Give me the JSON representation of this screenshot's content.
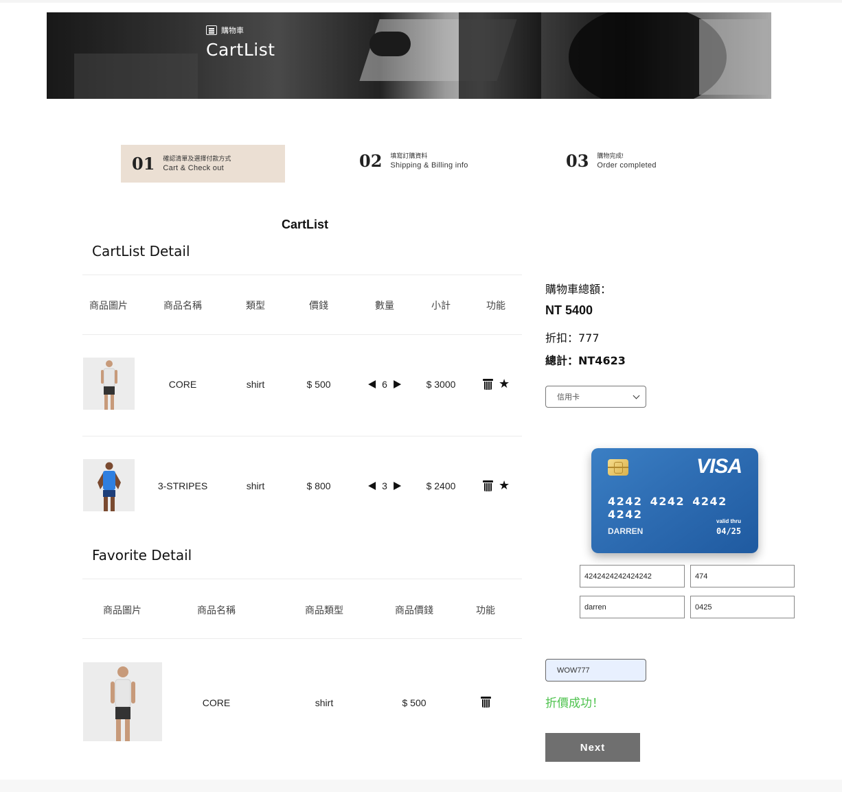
{
  "banner": {
    "subtitle": "購物車",
    "title": "CartList",
    "icon": "list-icon"
  },
  "steps": [
    {
      "num": "01",
      "zh": "確認清單及選擇付款方式",
      "en": "Cart & Check out",
      "active": true
    },
    {
      "num": "02",
      "zh": "填寫訂購資料",
      "en": "Shipping & Billing info",
      "active": false
    },
    {
      "num": "03",
      "zh": "購物完成!",
      "en": "Order completed",
      "active": false
    }
  ],
  "heading": "CartList",
  "cart": {
    "title": "CartList Detail",
    "headers": [
      "商品圖片",
      "商品名稱",
      "類型",
      "價錢",
      "數量",
      "小計",
      "功能"
    ],
    "rows": [
      {
        "name": "CORE",
        "type": "shirt",
        "price": "$ 500",
        "qty": "6",
        "subtotal": "$ 3000",
        "shirt_color": "#e6e6e6"
      },
      {
        "name": "3-STRIPES",
        "type": "shirt",
        "price": "$ 800",
        "qty": "3",
        "subtotal": "$ 2400",
        "shirt_color": "#2f7fe0"
      }
    ]
  },
  "favorite": {
    "title": "Favorite Detail",
    "headers": [
      "商品圖片",
      "商品名稱",
      "商品類型",
      "商品價錢",
      "功能"
    ],
    "rows": [
      {
        "name": "CORE",
        "type": "shirt",
        "price": "$ 500",
        "shirt_color": "#e6e6e6"
      }
    ]
  },
  "summary": {
    "label": "購物車總額：",
    "total": "NT 5400",
    "discount": "折扣：777",
    "final": "總計：NT4623"
  },
  "payment": {
    "selected": "信用卡"
  },
  "card": {
    "brand": "VISA",
    "number": "4242 4242 4242 4242",
    "name": "DARREN",
    "valid_label": "valid thru",
    "expiry": "04/25",
    "gradient": [
      "#3b7fc4",
      "#1f5aa0"
    ]
  },
  "fields": {
    "number": "4242424242424242",
    "cvc": "474",
    "name": "darren",
    "expiry": "0425"
  },
  "coupon": {
    "value": "WOW777"
  },
  "coupon_message": "折價成功！",
  "next_label": "Next",
  "colors": {
    "step_active_bg": "#ebdfd3",
    "success": "#4cc24c",
    "next_bg": "#6f6f6f"
  }
}
